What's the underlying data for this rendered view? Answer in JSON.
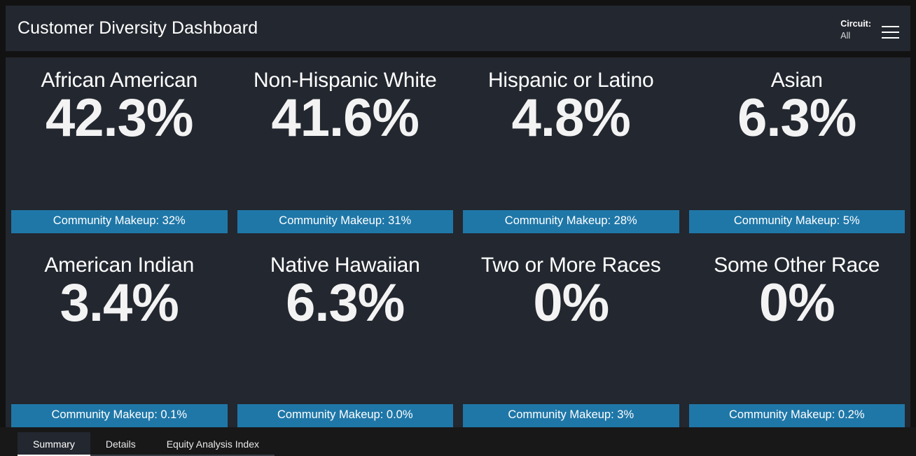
{
  "header": {
    "title": "Customer Diversity Dashboard",
    "filter_label": "Circuit:",
    "filter_value": "All",
    "menu_icon": "hamburger-menu-icon"
  },
  "kpis": [
    {
      "title": "African American",
      "value": "42.3%",
      "banner": "Community Makeup: 32%"
    },
    {
      "title": "Non-Hispanic White",
      "value": "41.6%",
      "banner": "Community Makeup: 31%"
    },
    {
      "title": "Hispanic or Latino",
      "value": "4.8%",
      "banner": "Community Makeup: 28%"
    },
    {
      "title": "Asian",
      "value": "6.3%",
      "banner": "Community Makeup: 5%"
    },
    {
      "title": "American Indian",
      "value": "3.4%",
      "banner": "Community Makeup: 0.1%"
    },
    {
      "title": "Native Hawaiian",
      "value": "6.3%",
      "banner": "Community Makeup: 0.0%"
    },
    {
      "title": "Two or More Races",
      "value": "0%",
      "banner": "Community Makeup: 3%"
    },
    {
      "title": "Some Other Race",
      "value": "0%",
      "banner": "Community Makeup: 0.2%"
    }
  ],
  "tabs": [
    {
      "label": "Summary",
      "active": true
    },
    {
      "label": "Details",
      "active": false
    },
    {
      "label": "Equity Analysis Index",
      "active": false
    }
  ],
  "colors": {
    "page_background": "#121212",
    "panel_background": "#23272f",
    "banner_blue": "#1f77a8",
    "tabbar_background": "#181818",
    "text_primary": "#ffffff",
    "text_secondary": "#d8dade"
  }
}
